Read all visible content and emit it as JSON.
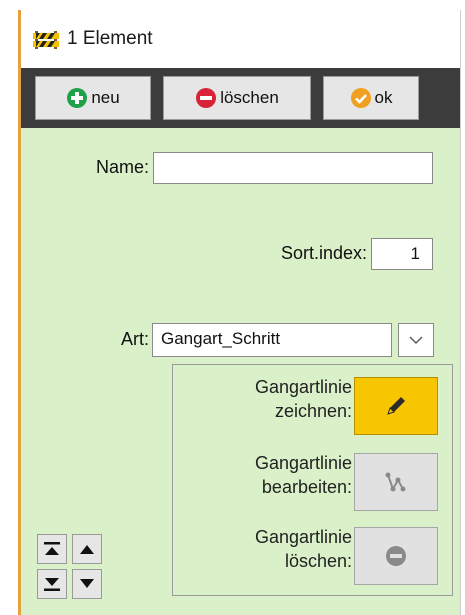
{
  "window": {
    "title": "1 Element",
    "title_icon": "barrier-icon"
  },
  "toolbar": {
    "new_label": "neu",
    "delete_label": "löschen",
    "ok_label": "ok"
  },
  "form": {
    "name_label": "Name:",
    "name_value": "",
    "sort_label": "Sort.index:",
    "sort_value": "1",
    "type_label": "Art:",
    "type_value": "Gangart_Schritt"
  },
  "panel": {
    "draw_label": "Gangartlinie zeichnen:",
    "edit_label": "Gangartlinie bearbeiten:",
    "delete_label": "Gangartlinie löschen:"
  },
  "colors": {
    "background": "#d9f0c8",
    "toolbar": "#3c3c3c",
    "active_button": "#f7c600",
    "new_icon": "#1fa14a",
    "delete_icon": "#d9213a",
    "ok_icon": "#f0a020"
  }
}
